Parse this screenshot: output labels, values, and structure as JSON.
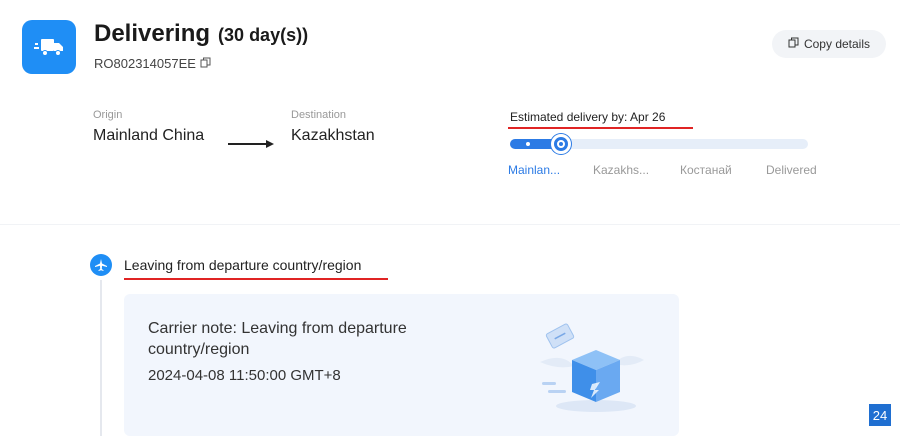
{
  "header": {
    "status": "Delivering",
    "days": "(30 day(s))",
    "tracking_number": "RO802314057EE",
    "copy_label": "Copy details"
  },
  "route": {
    "origin_label": "Origin",
    "origin_value": "Mainland China",
    "destination_label": "Destination",
    "destination_value": "Kazakhstan"
  },
  "eta": {
    "text": "Estimated delivery by:  Apr 26"
  },
  "progress": {
    "fraction": 0.17,
    "stages": [
      "Mainlan...",
      "Kazakhs...",
      "Костанай",
      "Delivered"
    ],
    "active_stage": 0
  },
  "event": {
    "title": "Leaving from departure country/region",
    "note": "Carrier note: Leaving from departure country/region",
    "time": "2024-04-08 11:50:00 GMT+8"
  },
  "page_badge": "24",
  "icons": {
    "status": "truck-icon",
    "tracking_copy": "copy-icon",
    "copy_button": "copy-icon",
    "event": "airplane-icon",
    "illustration": "package-box-icon"
  },
  "colors": {
    "accent": "#1f8ef5",
    "progress": "#2c7be5",
    "highlight_underline": "#e02424",
    "card_background": "#f2f6fd"
  }
}
